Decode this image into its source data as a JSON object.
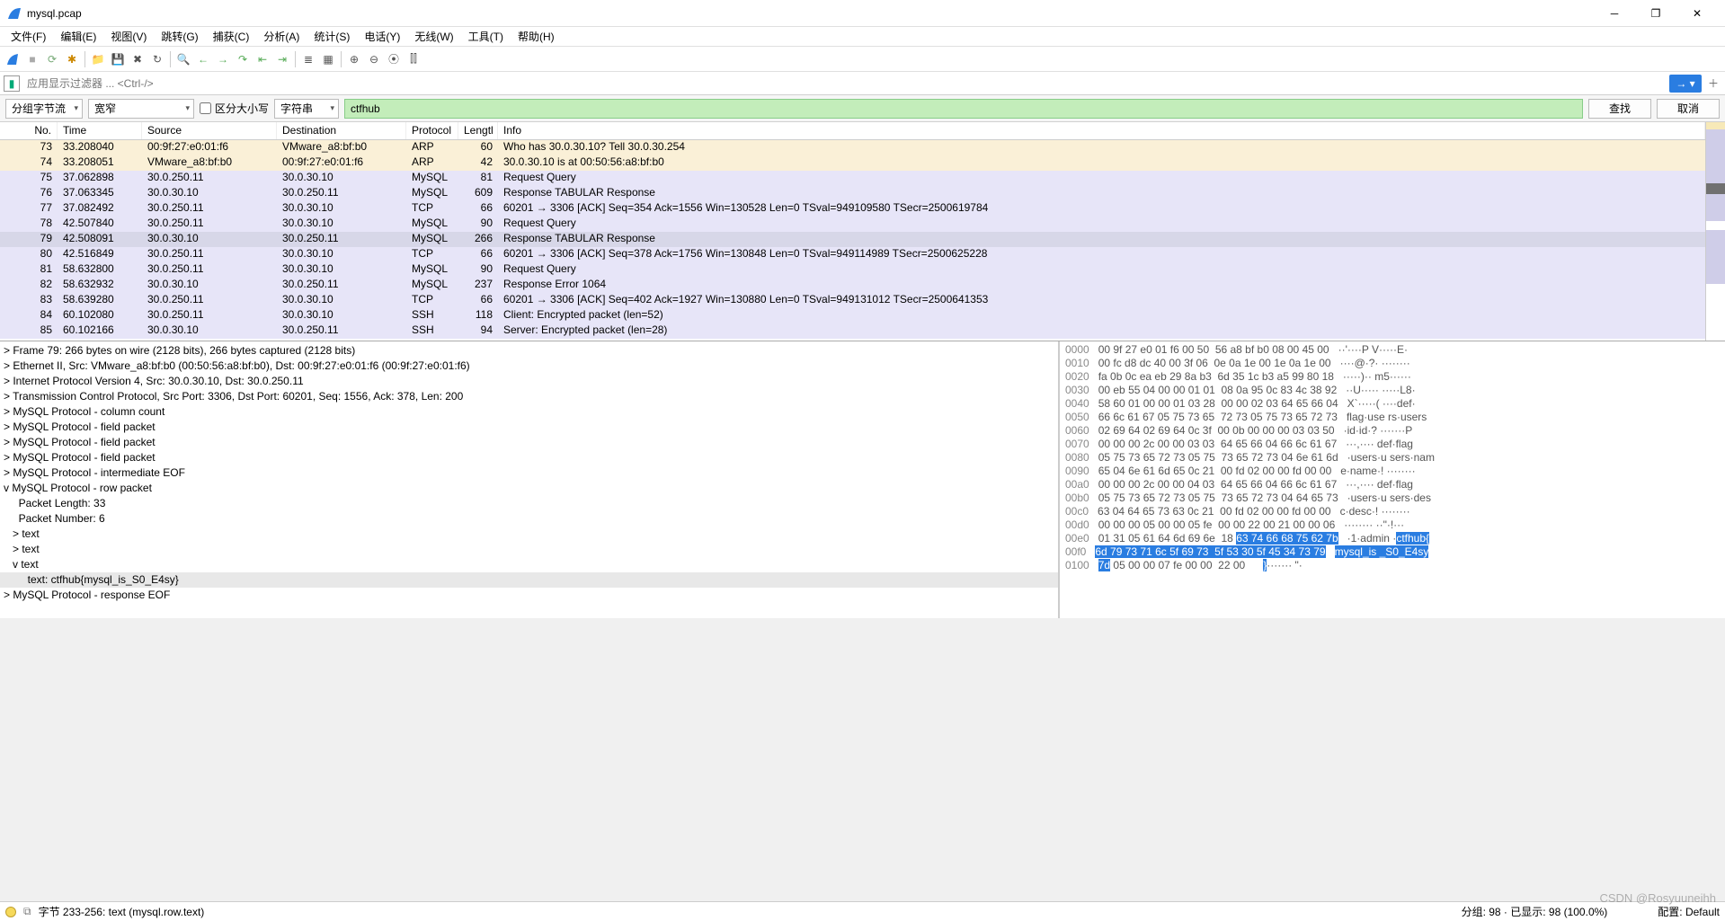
{
  "title": "mysql.pcap",
  "menu": [
    "文件(F)",
    "编辑(E)",
    "视图(V)",
    "跳转(G)",
    "捕获(C)",
    "分析(A)",
    "统计(S)",
    "电话(Y)",
    "无线(W)",
    "工具(T)",
    "帮助(H)"
  ],
  "filter_placeholder": "应用显示过滤器 ... <Ctrl-/>",
  "searchbar": {
    "stream": "分组字节流",
    "width": "宽窄",
    "case": "区分大小写",
    "type": "字符串",
    "term": "ctfhub",
    "find": "查找",
    "cancel": "取消"
  },
  "columns": {
    "no": "No.",
    "time": "Time",
    "src": "Source",
    "dst": "Destination",
    "proto": "Protocol",
    "len": "Lengtl",
    "info": "Info"
  },
  "rows": [
    {
      "no": "73",
      "time": "33.208040",
      "src": "00:9f:27:e0:01:f6",
      "dst": "VMware_a8:bf:b0",
      "proto": "ARP",
      "len": "60",
      "info": "Who has 30.0.30.10? Tell 30.0.30.254",
      "cls": "bg-arp"
    },
    {
      "no": "74",
      "time": "33.208051",
      "src": "VMware_a8:bf:b0",
      "dst": "00:9f:27:e0:01:f6",
      "proto": "ARP",
      "len": "42",
      "info": "30.0.30.10 is at 00:50:56:a8:bf:b0",
      "cls": "bg-arp"
    },
    {
      "no": "75",
      "time": "37.062898",
      "src": "30.0.250.11",
      "dst": "30.0.30.10",
      "proto": "MySQL",
      "len": "81",
      "info": "Request Query",
      "cls": "bg-mysql"
    },
    {
      "no": "76",
      "time": "37.063345",
      "src": "30.0.30.10",
      "dst": "30.0.250.11",
      "proto": "MySQL",
      "len": "609",
      "info": "Response TABULAR Response",
      "cls": "bg-mysql"
    },
    {
      "no": "77",
      "time": "37.082492",
      "src": "30.0.250.11",
      "dst": "30.0.30.10",
      "proto": "TCP",
      "len": "66",
      "info": "60201 → 3306 [ACK] Seq=354 Ack=1556 Win=130528 Len=0 TSval=949109580 TSecr=2500619784",
      "cls": "bg-tcp"
    },
    {
      "no": "78",
      "time": "42.507840",
      "src": "30.0.250.11",
      "dst": "30.0.30.10",
      "proto": "MySQL",
      "len": "90",
      "info": "Request Query",
      "cls": "bg-mysql"
    },
    {
      "no": "79",
      "time": "42.508091",
      "src": "30.0.30.10",
      "dst": "30.0.250.11",
      "proto": "MySQL",
      "len": "266",
      "info": "Response TABULAR Response",
      "cls": "bg-mysql sel"
    },
    {
      "no": "80",
      "time": "42.516849",
      "src": "30.0.250.11",
      "dst": "30.0.30.10",
      "proto": "TCP",
      "len": "66",
      "info": "60201 → 3306 [ACK] Seq=378 Ack=1756 Win=130848 Len=0 TSval=949114989 TSecr=2500625228",
      "cls": "bg-tcp"
    },
    {
      "no": "81",
      "time": "58.632800",
      "src": "30.0.250.11",
      "dst": "30.0.30.10",
      "proto": "MySQL",
      "len": "90",
      "info": "Request Query",
      "cls": "bg-mysql"
    },
    {
      "no": "82",
      "time": "58.632932",
      "src": "30.0.30.10",
      "dst": "30.0.250.11",
      "proto": "MySQL",
      "len": "237",
      "info": "Response  Error 1064",
      "cls": "bg-mysql"
    },
    {
      "no": "83",
      "time": "58.639280",
      "src": "30.0.250.11",
      "dst": "30.0.30.10",
      "proto": "TCP",
      "len": "66",
      "info": "60201 → 3306 [ACK] Seq=402 Ack=1927 Win=130880 Len=0 TSval=949131012 TSecr=2500641353",
      "cls": "bg-tcp"
    },
    {
      "no": "84",
      "time": "60.102080",
      "src": "30.0.250.11",
      "dst": "30.0.30.10",
      "proto": "SSH",
      "len": "118",
      "info": "Client: Encrypted packet (len=52)",
      "cls": "bg-ssh"
    },
    {
      "no": "85",
      "time": "60.102166",
      "src": "30.0.30.10",
      "dst": "30.0.250.11",
      "proto": "SSH",
      "len": "94",
      "info": "Server: Encrypted packet (len=28)",
      "cls": "bg-ssh"
    }
  ],
  "tree": [
    {
      "t": "> Frame 79: 266 bytes on wire (2128 bits), 266 bytes captured (2128 bits)"
    },
    {
      "t": "> Ethernet II, Src: VMware_a8:bf:b0 (00:50:56:a8:bf:b0), Dst: 00:9f:27:e0:01:f6 (00:9f:27:e0:01:f6)"
    },
    {
      "t": "> Internet Protocol Version 4, Src: 30.0.30.10, Dst: 30.0.250.11"
    },
    {
      "t": "> Transmission Control Protocol, Src Port: 3306, Dst Port: 60201, Seq: 1556, Ack: 378, Len: 200"
    },
    {
      "t": "> MySQL Protocol - column count"
    },
    {
      "t": "> MySQL Protocol - field packet"
    },
    {
      "t": "> MySQL Protocol - field packet"
    },
    {
      "t": "> MySQL Protocol - field packet"
    },
    {
      "t": "> MySQL Protocol - intermediate EOF"
    },
    {
      "t": "v MySQL Protocol - row packet"
    },
    {
      "t": "     Packet Length: 33"
    },
    {
      "t": "     Packet Number: 6"
    },
    {
      "t": "   > text"
    },
    {
      "t": "   > text"
    },
    {
      "t": "   v text"
    },
    {
      "t": "        text: ctfhub{mysql_is_S0_E4sy}",
      "sel": true
    },
    {
      "t": "> MySQL Protocol - response EOF"
    }
  ],
  "hex": [
    {
      "off": "0000",
      "b": "00 9f 27 e0 01 f6 00 50  56 a8 bf b0 08 00 45 00",
      "a": "··'····P V·····E·"
    },
    {
      "off": "0010",
      "b": "00 fc d8 dc 40 00 3f 06  0e 0a 1e 00 1e 0a 1e 00",
      "a": "····@·?· ········"
    },
    {
      "off": "0020",
      "b": "fa 0b 0c ea eb 29 8a b3  6d 35 1c b3 a5 99 80 18",
      "a": "·····)·· m5······"
    },
    {
      "off": "0030",
      "b": "00 eb 55 04 00 00 01 01  08 0a 95 0c 83 4c 38 92",
      "a": "··U····· ·····L8·"
    },
    {
      "off": "0040",
      "b": "58 60 01 00 00 01 03 28  00 00 02 03 64 65 66 04",
      "a": "X`·····( ····def·"
    },
    {
      "off": "0050",
      "b": "66 6c 61 67 05 75 73 65  72 73 05 75 73 65 72 73",
      "a": "flag·use rs·users"
    },
    {
      "off": "0060",
      "b": "02 69 64 02 69 64 0c 3f  00 0b 00 00 00 03 03 50",
      "a": "·id·id·? ·······P"
    },
    {
      "off": "0070",
      "b": "00 00 00 2c 00 00 03 03  64 65 66 04 66 6c 61 67",
      "a": "···,···· def·flag"
    },
    {
      "off": "0080",
      "b": "05 75 73 65 72 73 05 75  73 65 72 73 04 6e 61 6d",
      "a": "·users·u sers·nam"
    },
    {
      "off": "0090",
      "b": "65 04 6e 61 6d 65 0c 21  00 fd 02 00 00 fd 00 00",
      "a": "e·name·! ········"
    },
    {
      "off": "00a0",
      "b": "00 00 00 2c 00 00 04 03  64 65 66 04 66 6c 61 67",
      "a": "···,···· def·flag"
    },
    {
      "off": "00b0",
      "b": "05 75 73 65 72 73 05 75  73 65 72 73 04 64 65 73",
      "a": "·users·u sers·des"
    },
    {
      "off": "00c0",
      "b": "63 04 64 65 73 63 0c 21  00 fd 02 00 00 fd 00 00",
      "a": "c·desc·! ········"
    },
    {
      "off": "00d0",
      "b": "00 00 00 05 00 00 05 fe  00 00 22 00 21 00 00 06",
      "a": "········ ··\"·!···"
    }
  ],
  "hex_hi": [
    {
      "off": "00e0",
      "pre": "01 31 05 61 64 6d 69 6e  18 ",
      "hi": "63 74 66 68 75 62 7b",
      "apre": "·1·admin ·",
      "ahi": "ctfhub{"
    },
    {
      "off": "00f0",
      "pre": "",
      "hi": "6d 79 73 71 6c 5f 69 73  5f 53 30 5f 45 34 73 79",
      "apre": "",
      "ahi": "mysql_is _S0_E4sy"
    },
    {
      "off": "0100",
      "pre": "",
      "hi": "7d",
      "post": " 05 00 00 07 fe 00 00  22 00",
      "apre": "",
      "ahi": "}",
      "apost": "······· \"·"
    }
  ],
  "statusbar": {
    "left": "字节 233-256: text (mysql.row.text)",
    "right": "分组: 98 · 已显示: 98 (100.0%)",
    "profile": "配置: Default"
  },
  "watermark": "CSDN @Rosyuuneihh"
}
